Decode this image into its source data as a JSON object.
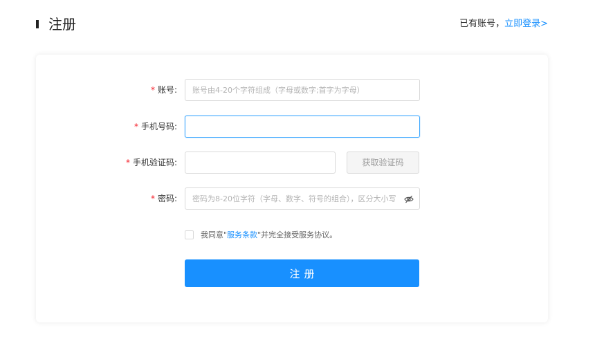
{
  "header": {
    "title": "注册",
    "login_prompt": "已有账号，",
    "login_link": "立即登录>"
  },
  "form": {
    "account": {
      "required_mark": "*",
      "label": "账号:",
      "value": "",
      "placeholder": "账号由4-20个字符组成（字母或数字;首字为字母）"
    },
    "phone": {
      "required_mark": "*",
      "label": "手机号码:",
      "value": "",
      "placeholder": ""
    },
    "sms_code": {
      "required_mark": "*",
      "label": "手机验证码:",
      "value": "",
      "placeholder": "",
      "button_label": "获取验证码"
    },
    "password": {
      "required_mark": "*",
      "label": "密码:",
      "value": "",
      "placeholder": "密码为8-20位字符（字母、数字、符号的组合），区分大小写",
      "toggle_icon": "eye-slash-icon"
    },
    "agreement": {
      "checked": false,
      "prefix": "我同意\"",
      "link": "服务条款",
      "suffix": "\"并完全接受服务协议。"
    },
    "submit_label": "注册"
  },
  "colors": {
    "primary": "#1890ff",
    "required": "#f5222d",
    "disabled_bg": "#f5f5f5"
  }
}
